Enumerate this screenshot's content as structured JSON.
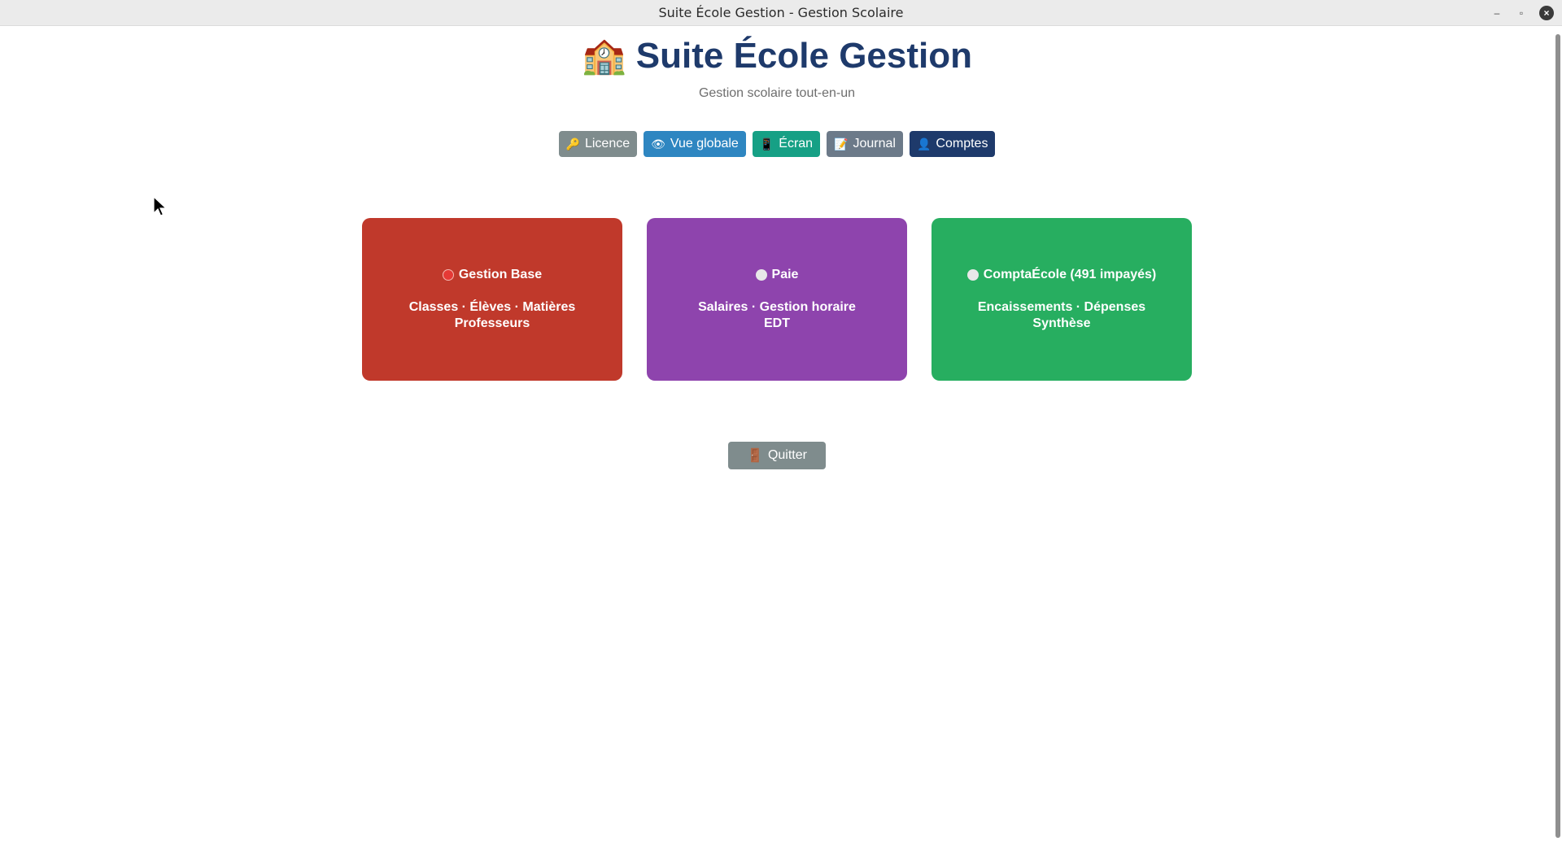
{
  "window": {
    "title": "Suite École Gestion - Gestion Scolaire",
    "controls": {
      "minimize": "–",
      "maximize": "▫",
      "close": "×"
    }
  },
  "header": {
    "icon": "🏫",
    "title": "Suite École Gestion",
    "subtitle": "Gestion scolaire tout-en-un"
  },
  "toolbar": [
    {
      "icon": "🔑",
      "label": "Licence",
      "color": "#7f8c8d"
    },
    {
      "icon": "👁",
      "label": "Vue globale",
      "color": "#2e86c1"
    },
    {
      "icon": "📱",
      "label": "Écran",
      "color": "#16a085"
    },
    {
      "icon": "📝",
      "label": "Journal",
      "color": "#6c7a89"
    },
    {
      "icon": "👤",
      "label": "Comptes",
      "color": "#1e3a6b"
    }
  ],
  "cards": [
    {
      "status_color": "#e53935",
      "title": "Gestion Base",
      "line1": "Classes · Élèves · Matières",
      "line2": "Professeurs",
      "color": "#c0392b"
    },
    {
      "status_color": "#e8e8e8",
      "title": "Paie",
      "line1": "Salaires · Gestion horaire",
      "line2": "EDT",
      "color": "#8e44ad"
    },
    {
      "status_color": "#e8e8e8",
      "title": "ComptaÉcole (491 impayés)",
      "line1": "Encaissements · Dépenses",
      "line2": "Synthèse",
      "color": "#27ae60"
    }
  ],
  "quit": {
    "icon": "🚪",
    "label": "Quitter"
  }
}
